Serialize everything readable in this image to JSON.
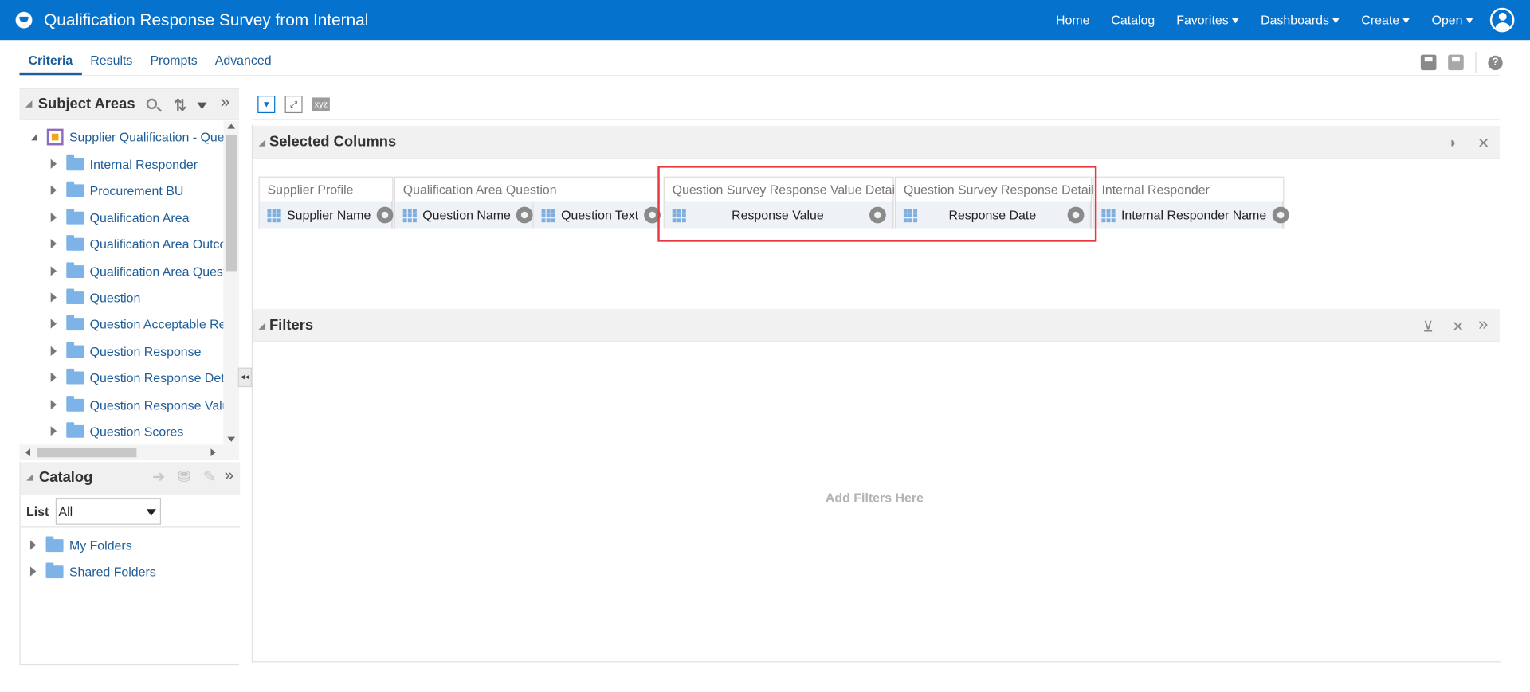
{
  "app": {
    "title": "Qualification Response Survey from Internal",
    "nav": [
      "Home",
      "Catalog",
      "Favorites",
      "Dashboards",
      "Create",
      "Open"
    ],
    "nav_with_menu": [
      "Favorites",
      "Dashboards",
      "Create",
      "Open"
    ]
  },
  "tabs": [
    "Criteria",
    "Results",
    "Prompts",
    "Advanced"
  ],
  "active_tab": "Criteria",
  "subject_areas": {
    "title": "Subject Areas",
    "root": "Supplier Qualification - Ques",
    "items": [
      "Internal Responder",
      "Procurement BU",
      "Qualification Area",
      "Qualification Area Outcor",
      "Qualification Area Questi",
      "Question",
      "Question Acceptable Res",
      "Question Response",
      "Question Response Deta",
      "Question Response Valu",
      "Question Scores"
    ]
  },
  "catalog": {
    "title": "Catalog",
    "list_label": "List",
    "list_value": "All",
    "folders": [
      "My Folders",
      "Shared Folders"
    ]
  },
  "selected_columns": {
    "title": "Selected Columns",
    "groups": [
      {
        "name": "Supplier Profile",
        "columns": [
          "Supplier Name"
        ]
      },
      {
        "name": "Qualification Area Question",
        "columns": [
          "Question Name",
          "Question Text"
        ]
      },
      {
        "name": "Question Survey Response Value Detail",
        "columns": [
          "Response Value"
        ]
      },
      {
        "name": "Question Survey Response Detail",
        "columns": [
          "Response Date"
        ]
      },
      {
        "name": "Internal Responder",
        "columns": [
          "Internal Responder Name"
        ]
      }
    ]
  },
  "filters": {
    "title": "Filters",
    "empty_hint": "Add Filters Here"
  },
  "colors": {
    "brand_bar": "#0572ce",
    "link": "#1d5d99",
    "highlight_box": "#e8383d"
  }
}
